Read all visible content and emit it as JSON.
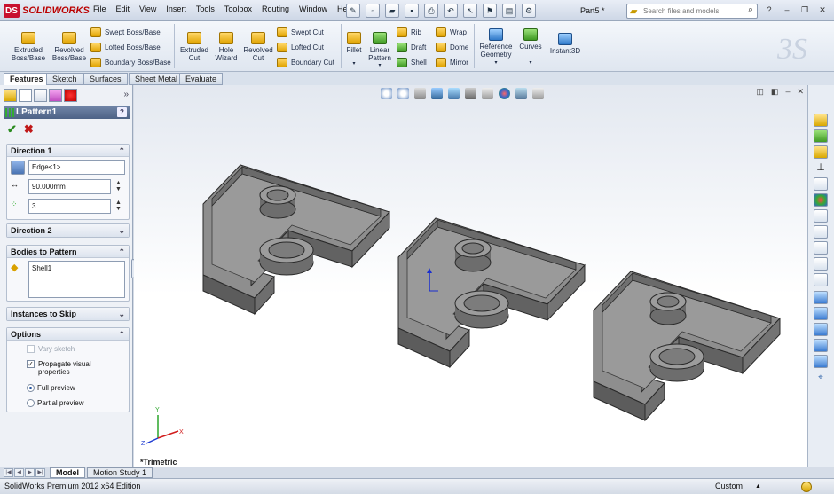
{
  "app": {
    "logo_text": "SOLIDWORKS",
    "document_title": "Part5 *"
  },
  "menu": [
    "File",
    "Edit",
    "View",
    "Insert",
    "Tools",
    "Toolbox",
    "Routing",
    "Window",
    "Help"
  ],
  "search": {
    "placeholder": "Search files and models"
  },
  "ribbon": {
    "extruded_boss": "Extruded Boss/Base",
    "revolved_boss": "Revolved Boss/Base",
    "swept_boss": "Swept Boss/Base",
    "lofted_boss": "Lofted Boss/Base",
    "boundary_boss": "Boundary Boss/Base",
    "extruded_cut": "Extruded Cut",
    "hole_wizard": "Hole Wizard",
    "revolved_cut": "Revolved Cut",
    "swept_cut": "Swept Cut",
    "lofted_cut": "Lofted Cut",
    "boundary_cut": "Boundary Cut",
    "fillet": "Fillet",
    "linear_pattern": "Linear Pattern",
    "rib": "Rib",
    "draft": "Draft",
    "shell": "Shell",
    "wrap": "Wrap",
    "dome": "Dome",
    "mirror": "Mirror",
    "reference_geometry": "Reference Geometry",
    "curves": "Curves",
    "instant3d": "Instant3D"
  },
  "tabs": [
    "Features",
    "Sketch",
    "Surfaces",
    "Sheet Metal",
    "Evaluate"
  ],
  "property_manager": {
    "title": "LPattern1",
    "help": "?",
    "direction1": {
      "header": "Direction 1",
      "edge": "Edge<1>",
      "distance": "90.000mm",
      "instances": "3"
    },
    "direction2": {
      "header": "Direction 2"
    },
    "bodies": {
      "header": "Bodies to Pattern",
      "item": "Shell1"
    },
    "skip": {
      "header": "Instances to Skip"
    },
    "options": {
      "header": "Options",
      "vary_sketch": "Vary sketch",
      "vary_sketch_checked": false,
      "propagate": "Propagate visual properties",
      "propagate_checked": true,
      "full_preview": "Full preview",
      "partial_preview": "Partial preview",
      "selected_preview": "full"
    }
  },
  "viewport": {
    "view_label": "*Trimetric"
  },
  "bottom_tabs": [
    "Model",
    "Motion Study 1"
  ],
  "status": {
    "edition": "SolidWorks Premium 2012 x64 Edition",
    "units": "Custom"
  },
  "colors": {
    "part_gray": "#8c8c8c",
    "accent_blue": "#4d6286",
    "ok_green": "#2a8b1f",
    "cancel_red": "#c01818"
  }
}
